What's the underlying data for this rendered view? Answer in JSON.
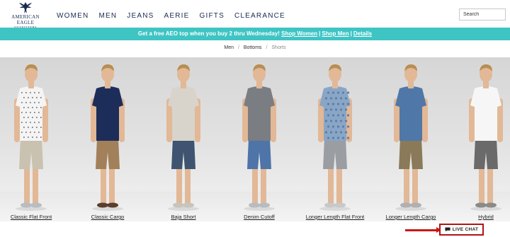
{
  "brand": {
    "name": "AMERICAN EAGLE",
    "sub": "OUTFITTERS"
  },
  "nav": [
    "WOMEN",
    "MEN",
    "JEANS",
    "AERIE",
    "GIFTS",
    "CLEARANCE"
  ],
  "search": {
    "placeholder": "Search"
  },
  "promo": {
    "text": "Get a free AEO top when you buy 2 thru Wednesday!",
    "link_women": "Shop Women",
    "separator": "|",
    "link_men": "Shop Men",
    "link_details": "Details"
  },
  "breadcrumb": {
    "items": [
      "Men",
      "Bottoms"
    ],
    "current": "Shorts",
    "sep": "/"
  },
  "products": [
    {
      "label": "Classic Flat Front",
      "shirt": "#f4f4f4",
      "shirt_pattern": "dots",
      "shorts": "#c9c2b0",
      "shoes": "#b9bcc0"
    },
    {
      "label": "Classic Cargo",
      "shirt": "#1d2d5a",
      "shirt_pattern": "none",
      "shorts": "#a2805a",
      "shoes": "#5a3f2c"
    },
    {
      "label": "Baja Short",
      "shirt": "#d8d4cc",
      "shirt_pattern": "none",
      "shorts": "#3e5470",
      "shoes": "#c8c4bc"
    },
    {
      "label": "Denim Cutoff",
      "shirt": "#7a7e82",
      "shirt_pattern": "none",
      "shorts": "#4e74a8",
      "shoes": "#b8bcc0"
    },
    {
      "label": "Longer Length Flat Front",
      "shirt": "#8aa6c6",
      "shirt_pattern": "print",
      "shorts": "#9a9ea2",
      "shoes": "#c8c8c8"
    },
    {
      "label": "Longer Length Cargo",
      "shirt": "#4f78a8",
      "shirt_pattern": "none",
      "shorts": "#8a7a5a",
      "shoes": "#b0b0b0"
    },
    {
      "label": "Hybrid",
      "shirt": "#f6f6f6",
      "shirt_pattern": "none",
      "shorts": "#6a6a6a",
      "shoes": "#8a8a8a"
    }
  ],
  "live_chat": {
    "label": "LIVE CHAT"
  },
  "colors": {
    "promo_bg": "#3fc4c4",
    "navy": "#1a2a4f",
    "highlight": "#c81818"
  }
}
